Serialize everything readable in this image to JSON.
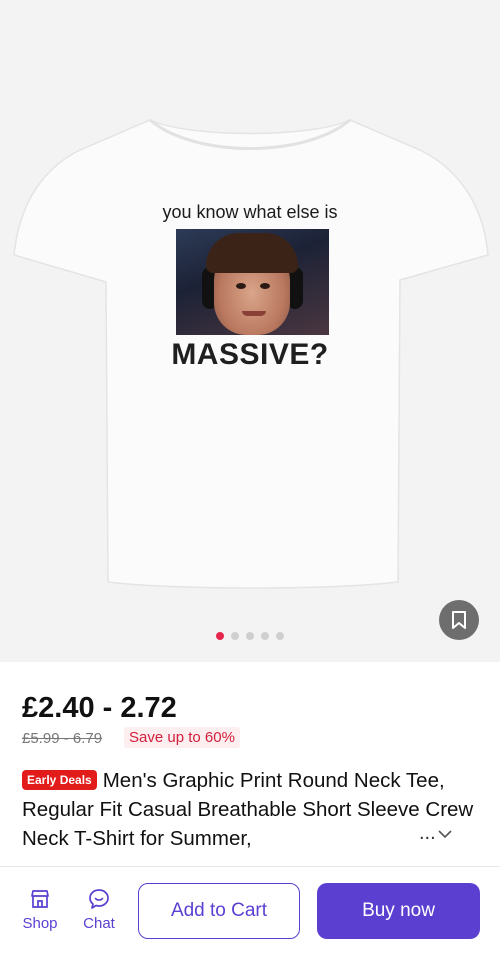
{
  "gallery": {
    "print_text_top": "you know what else is",
    "print_text_bottom": "MASSIVE?",
    "dots_count": 5,
    "active_dot": 0
  },
  "product": {
    "price": "£2.40 - 2.72",
    "original_price": "£5.99 - 6.79",
    "save_label": "Save up to 60%",
    "deal_tag": "Early Deals",
    "title": "Men's Graphic Print Round Neck Tee, Regular Fit Casual Breathable Short Sleeve Crew Neck T-Shirt for Summer,",
    "more_label": "..."
  },
  "bottom_bar": {
    "shop_label": "Shop",
    "chat_label": "Chat",
    "add_to_cart_label": "Add to Cart",
    "buy_now_label": "Buy now"
  },
  "colors": {
    "accent": "#5b3fd1",
    "deal_red": "#e21b1b",
    "active_dot": "#e5254c"
  }
}
